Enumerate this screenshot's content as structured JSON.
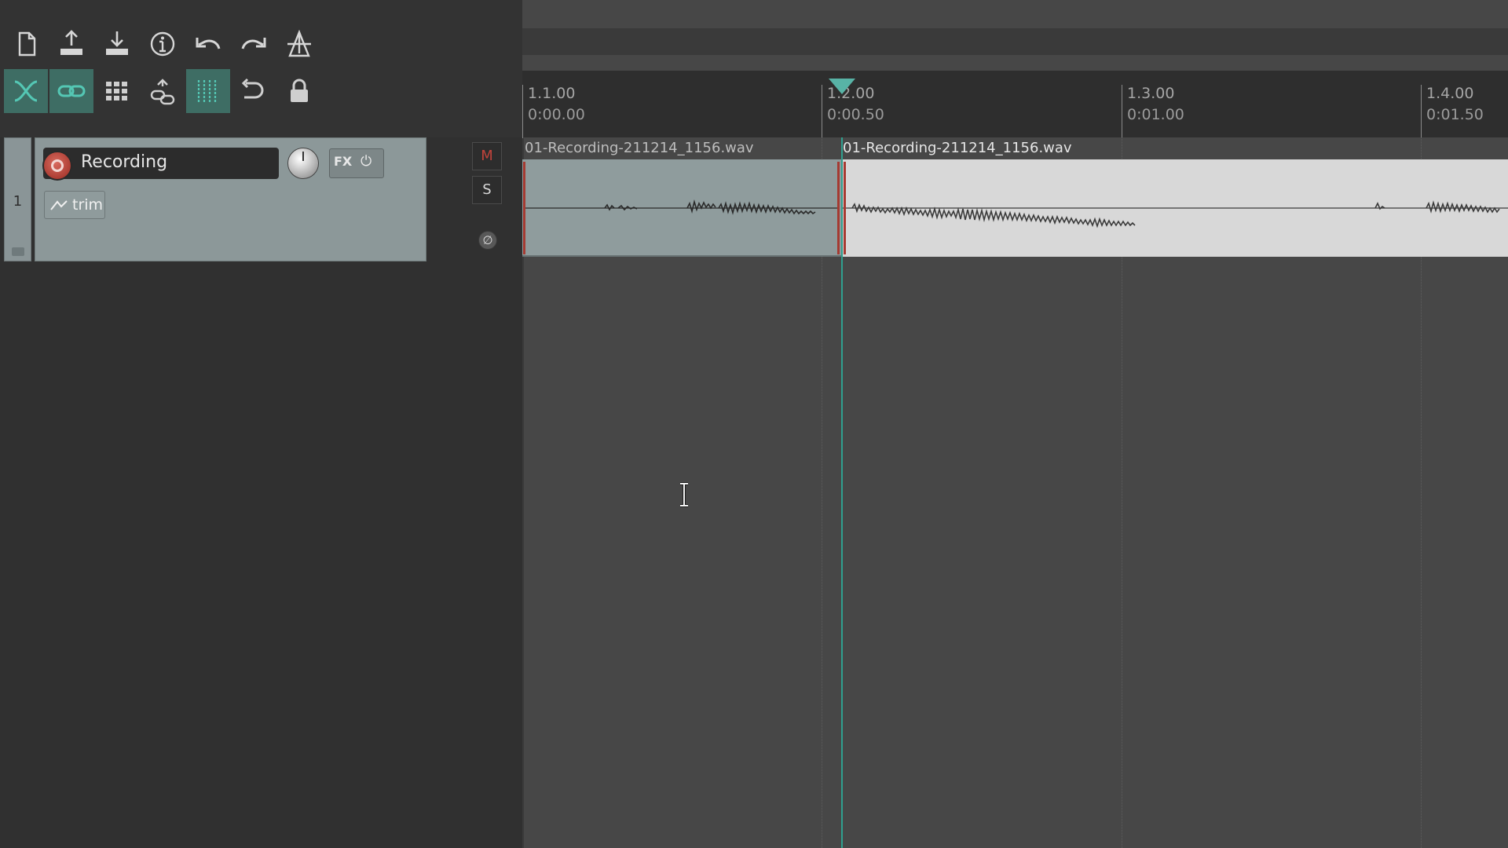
{
  "toolbar": {
    "row1": [
      {
        "icon": "new-project-icon"
      },
      {
        "icon": "open-project-icon"
      },
      {
        "icon": "save-project-icon"
      },
      {
        "icon": "project-info-icon"
      },
      {
        "icon": "undo-icon"
      },
      {
        "icon": "redo-icon"
      },
      {
        "icon": "metronome-icon"
      }
    ],
    "row2": [
      {
        "icon": "auto-crossfade-icon",
        "active": true
      },
      {
        "icon": "ripple-link-icon",
        "active": true
      },
      {
        "icon": "grid-snap-icon",
        "active": false
      },
      {
        "icon": "group-link-icon",
        "active": false
      },
      {
        "icon": "grid-lines-icon",
        "active": true
      },
      {
        "icon": "loop-icon",
        "active": false
      },
      {
        "icon": "lock-icon",
        "active": false
      }
    ]
  },
  "track": {
    "number": "1",
    "name": "Recording",
    "fx_label": "FX",
    "power_symbol": "⏻",
    "trim_label": "trim",
    "mute_label": "M",
    "solo_label": "S",
    "phase_symbol": "∅"
  },
  "ruler": {
    "markers": [
      {
        "bar": "1.1.00",
        "time": "0:00.00"
      },
      {
        "bar": "1.2.00",
        "time": "0:00.50"
      },
      {
        "bar": "1.3.00",
        "time": "0:01.00"
      },
      {
        "bar": "1.4.00",
        "time": "0:01.50"
      }
    ]
  },
  "items": [
    {
      "label": "01-Recording-211214_1156.wav"
    },
    {
      "label": "01-Recording-211214_1156.wav"
    }
  ],
  "colors": {
    "accent": "#2fa08f",
    "item_selected": "#d8d8d8",
    "item_unselected": "#8f9c9d",
    "record_arm": "#c0433b"
  }
}
